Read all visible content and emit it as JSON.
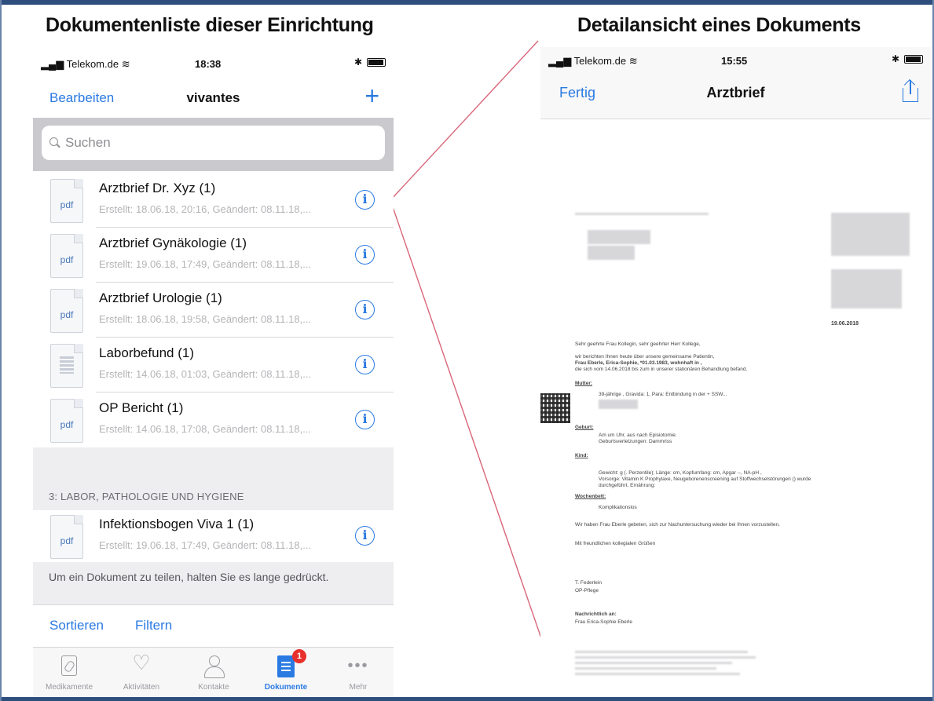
{
  "headings": {
    "left": "Dokumentenliste dieser Einrichtung",
    "right": "Detailansicht eines Dokuments"
  },
  "left_phone": {
    "status": {
      "carrier": "Telekom.de",
      "time": "18:38"
    },
    "nav": {
      "edit": "Bearbeiten",
      "title": "vivantes",
      "add": "+"
    },
    "search": {
      "placeholder": "Suchen"
    },
    "documents": [
      {
        "title": "Arztbrief Dr. Xyz (1)",
        "meta": "Erstellt: 18.06.18, 20:16, Geändert: 08.11.18,...",
        "type": "pdf"
      },
      {
        "title": "Arztbrief Gynäkologie (1)",
        "meta": "Erstellt: 19.06.18, 17:49, Geändert: 08.11.18,...",
        "type": "pdf"
      },
      {
        "title": "Arztbrief Urologie (1)",
        "meta": "Erstellt: 18.06.18, 19:58, Geändert: 08.11.18,...",
        "type": "pdf"
      },
      {
        "title": "Laborbefund (1)",
        "meta": "Erstellt: 14.06.18, 01:03, Geändert: 08.11.18,...",
        "type": "text"
      },
      {
        "title": "OP Bericht (1)",
        "meta": "Erstellt: 14.06.18, 17:08, Geändert: 08.11.18,...",
        "type": "pdf"
      }
    ],
    "section_header": "3: LABOR, PATHOLOGIE UND HYGIENE",
    "section_documents": [
      {
        "title": "Infektionsbogen Viva 1 (1)",
        "meta": "Erstellt: 19.06.18, 17:49, Geändert: 08.11.18,...",
        "type": "pdf"
      }
    ],
    "footer_note": "Um ein Dokument zu teilen, halten Sie es lange gedrückt.",
    "toolbar": {
      "sort": "Sortieren",
      "filter": "Filtern"
    },
    "tabs": [
      {
        "label": "Medikamente",
        "icon": "medication-icon"
      },
      {
        "label": "Aktivitäten",
        "icon": "heart-icon"
      },
      {
        "label": "Kontakte",
        "icon": "person-icon"
      },
      {
        "label": "Dokumente",
        "icon": "document-icon",
        "active": true,
        "badge": "1"
      },
      {
        "label": "Mehr",
        "icon": "more-icon"
      }
    ]
  },
  "right_phone": {
    "status": {
      "carrier": "Telekom.de",
      "time": "15:55"
    },
    "nav": {
      "done": "Fertig",
      "title": "Arztbrief"
    },
    "letter": {
      "date": "19.06.2018",
      "salutation": "Sehr geehrte Frau Kollegin, sehr geehrter Herr Kollege,",
      "intro": "wir berichten Ihnen heute über unsere gemeinsame Patientin,",
      "patient": "Frau Eberle, Erica-Sophie, *01.03.1983, wohnhaft in ,",
      "stay": "die sich vom 14.06.2018 bis zum  in unserer stationären Behandlung befand.",
      "mother_label": "Mutter:",
      "mother_text": "39-jährige , Gravida: 1, Para: Entbindung in der  + SSW...",
      "birth_label": "Geburt:",
      "birth_text": "Am  um  Uhr,  aus  nach Episiotomie.",
      "birth_text2": "Geburtsverletzungen: Dammriss",
      "child_label": "Kind:",
      "child_text": "Gewicht: g (. Perzentile); Länge: cm,  Kopfumfang:  cm, Apgar --, NA-pH ,",
      "child_text2": "Vorsorge: Vitamin K Prophylaxe, Neugeborenenscreening auf Stoffwechselstörungen () wurde",
      "child_text3": "durchgeführt. Ernährung:",
      "puerperium_label": "Wochenbett:",
      "puerperium_text": "Komplikationslos",
      "closing": "Wir haben Frau Eberle gebeten, sich zur Nachuntersuchung wieder bei Ihnen vorzustellen.",
      "greeting": "Mit freundlichen kollegialen Grüßen",
      "signer": "T. Federlein",
      "signer_role": "OP-Pflege",
      "cc_label": "Nachrichtlich an:",
      "cc_name": "Frau Erica-Sophie Eberle"
    }
  },
  "colors": {
    "accent": "#2a7ae2",
    "badge": "#e8312c",
    "connector": "#d9667a",
    "frame": "#2e4e7e"
  }
}
